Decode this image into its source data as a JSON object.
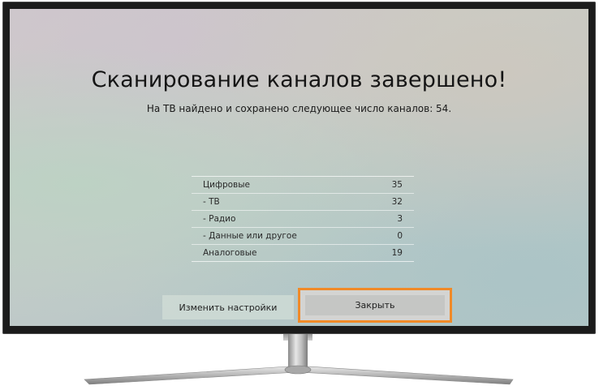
{
  "dialog": {
    "title": "Сканирование каналов завершено!",
    "subtitle": "На ТВ найдено и сохранено следующее число каналов: 54.",
    "rows": [
      {
        "label": "Цифровые",
        "value": "35"
      },
      {
        "label": "- ТВ",
        "value": "32"
      },
      {
        "label": "- Радио",
        "value": "3"
      },
      {
        "label": "- Данные или другое",
        "value": "0"
      },
      {
        "label": "Аналоговые",
        "value": "19"
      }
    ],
    "buttons": {
      "settings_label": "Изменить настройки",
      "close_label": "Закрыть"
    }
  },
  "colors": {
    "highlight": "#f08a28",
    "tv_bezel": "#1b1b1b"
  }
}
